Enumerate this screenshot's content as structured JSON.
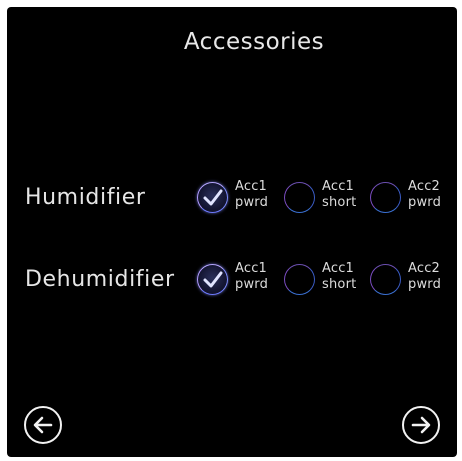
{
  "header": {
    "title": "Accessories"
  },
  "rows": [
    {
      "label": "Humidifier",
      "options": [
        {
          "line1": "Acc1",
          "line2": "pwrd",
          "checked": true
        },
        {
          "line1": "Acc1",
          "line2": "short",
          "checked": false
        },
        {
          "line1": "Acc2",
          "line2": "pwrd",
          "checked": false
        }
      ]
    },
    {
      "label": "Dehumidifier",
      "options": [
        {
          "line1": "Acc1",
          "line2": "pwrd",
          "checked": true
        },
        {
          "line1": "Acc1",
          "line2": "short",
          "checked": false
        },
        {
          "line1": "Acc2",
          "line2": "pwrd",
          "checked": false
        }
      ]
    }
  ],
  "nav": {
    "back_icon": "arrow-left-circle-icon",
    "next_icon": "arrow-right-circle-icon"
  },
  "colors": {
    "background": "#000000",
    "text": "#e6e6e6",
    "radio_outline": "#5b5fd0",
    "check_mark": "#e0e4ff"
  }
}
